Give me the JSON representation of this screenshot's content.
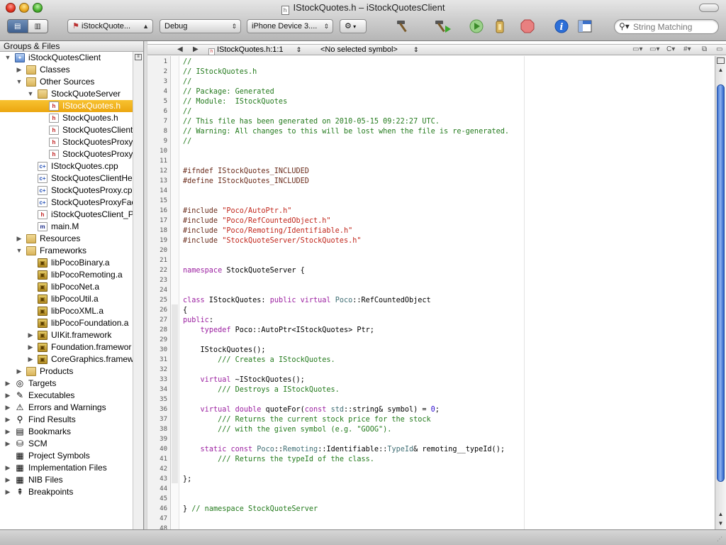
{
  "window": {
    "title": "IStockQuotes.h – iStockQuotesClient"
  },
  "toolbar": {
    "target": "iStockQuote...",
    "configuration": "Debug",
    "sdk": "iPhone Device 3....",
    "search_placeholder": "String Matching"
  },
  "sidebar": {
    "header": "Groups & Files",
    "items": [
      {
        "label": "iStockQuotesClient",
        "indent": 0,
        "disc": "open",
        "icon": "project"
      },
      {
        "label": "Classes",
        "indent": 1,
        "disc": "closed",
        "icon": "folder"
      },
      {
        "label": "Other Sources",
        "indent": 1,
        "disc": "open",
        "icon": "folder"
      },
      {
        "label": "StockQuoteServer",
        "indent": 2,
        "disc": "open",
        "icon": "folder"
      },
      {
        "label": "IStockQuotes.h",
        "indent": 3,
        "disc": "none",
        "icon": "h",
        "selected": true
      },
      {
        "label": "StockQuotes.h",
        "indent": 3,
        "disc": "none",
        "icon": "h"
      },
      {
        "label": "StockQuotesClient",
        "indent": 3,
        "disc": "none",
        "icon": "h"
      },
      {
        "label": "StockQuotesProxy.",
        "indent": 3,
        "disc": "none",
        "icon": "h"
      },
      {
        "label": "StockQuotesProxyF",
        "indent": 3,
        "disc": "none",
        "icon": "h"
      },
      {
        "label": "IStockQuotes.cpp",
        "indent": 2,
        "disc": "none",
        "icon": "cpp"
      },
      {
        "label": "StockQuotesClientHel",
        "indent": 2,
        "disc": "none",
        "icon": "cpp"
      },
      {
        "label": "StockQuotesProxy.cpp",
        "indent": 2,
        "disc": "none",
        "icon": "cpp"
      },
      {
        "label": "StockQuotesProxyFac",
        "indent": 2,
        "disc": "none",
        "icon": "cpp"
      },
      {
        "label": "iStockQuotesClient_Pr",
        "indent": 2,
        "disc": "none",
        "icon": "h"
      },
      {
        "label": "main.M",
        "indent": 2,
        "disc": "none",
        "icon": "m"
      },
      {
        "label": "Resources",
        "indent": 1,
        "disc": "closed",
        "icon": "folder"
      },
      {
        "label": "Frameworks",
        "indent": 1,
        "disc": "open",
        "icon": "folder"
      },
      {
        "label": "libPocoBinary.a",
        "indent": 2,
        "disc": "none",
        "icon": "lib"
      },
      {
        "label": "libPocoRemoting.a",
        "indent": 2,
        "disc": "none",
        "icon": "lib"
      },
      {
        "label": "libPocoNet.a",
        "indent": 2,
        "disc": "none",
        "icon": "lib"
      },
      {
        "label": "libPocoUtil.a",
        "indent": 2,
        "disc": "none",
        "icon": "lib"
      },
      {
        "label": "libPocoXML.a",
        "indent": 2,
        "disc": "none",
        "icon": "lib"
      },
      {
        "label": "libPocoFoundation.a",
        "indent": 2,
        "disc": "none",
        "icon": "lib"
      },
      {
        "label": "UIKit.framework",
        "indent": 2,
        "disc": "closed",
        "icon": "lib"
      },
      {
        "label": "Foundation.framewor",
        "indent": 2,
        "disc": "closed",
        "icon": "lib"
      },
      {
        "label": "CoreGraphics.framew",
        "indent": 2,
        "disc": "closed",
        "icon": "lib"
      },
      {
        "label": "Products",
        "indent": 1,
        "disc": "closed",
        "icon": "folder"
      },
      {
        "label": "Targets",
        "indent": 0,
        "disc": "closed",
        "icon": "group",
        "glyph": "◎"
      },
      {
        "label": "Executables",
        "indent": 0,
        "disc": "closed",
        "icon": "group",
        "glyph": "✎"
      },
      {
        "label": "Errors and Warnings",
        "indent": 0,
        "disc": "closed",
        "icon": "group",
        "glyph": "⚠"
      },
      {
        "label": "Find Results",
        "indent": 0,
        "disc": "closed",
        "icon": "group",
        "glyph": "⚲"
      },
      {
        "label": "Bookmarks",
        "indent": 0,
        "disc": "closed",
        "icon": "group",
        "glyph": "▤"
      },
      {
        "label": "SCM",
        "indent": 0,
        "disc": "closed",
        "icon": "group",
        "glyph": "⛁"
      },
      {
        "label": "Project Symbols",
        "indent": 0,
        "disc": "none",
        "icon": "group",
        "glyph": "▦"
      },
      {
        "label": "Implementation Files",
        "indent": 0,
        "disc": "closed",
        "icon": "group",
        "glyph": "▦"
      },
      {
        "label": "NIB Files",
        "indent": 0,
        "disc": "closed",
        "icon": "group",
        "glyph": "▦"
      },
      {
        "label": "Breakpoints",
        "indent": 0,
        "disc": "closed",
        "icon": "group",
        "glyph": "⇞"
      }
    ]
  },
  "navbar": {
    "file_location": "IStockQuotes.h:1:1",
    "symbol": "<No selected symbol>",
    "right_items": [
      "C",
      "#"
    ]
  },
  "editor": {
    "lines": [
      [
        [
          "c-com",
          "//"
        ]
      ],
      [
        [
          "c-com",
          "// IStockQuotes.h"
        ]
      ],
      [
        [
          "c-com",
          "//"
        ]
      ],
      [
        [
          "c-com",
          "// Package: Generated"
        ]
      ],
      [
        [
          "c-com",
          "// Module:  IStockQuotes"
        ]
      ],
      [
        [
          "c-com",
          "//"
        ]
      ],
      [
        [
          "c-com",
          "// This file has been generated on 2010-05-15 09:22:27 UTC."
        ]
      ],
      [
        [
          "c-com",
          "// Warning: All changes to this will be lost when the file is re-generated."
        ]
      ],
      [
        [
          "c-com",
          "//"
        ]
      ],
      [],
      [],
      [
        [
          "c-pp",
          "#ifndef IStockQuotes_INCLUDED"
        ]
      ],
      [
        [
          "c-pp",
          "#define IStockQuotes_INCLUDED"
        ]
      ],
      [],
      [],
      [
        [
          "c-pp",
          "#include "
        ],
        [
          "c-str",
          "\"Poco/AutoPtr.h\""
        ]
      ],
      [
        [
          "c-pp",
          "#include "
        ],
        [
          "c-str",
          "\"Poco/RefCountedObject.h\""
        ]
      ],
      [
        [
          "c-pp",
          "#include "
        ],
        [
          "c-str",
          "\"Poco/Remoting/Identifiable.h\""
        ]
      ],
      [
        [
          "c-pp",
          "#include "
        ],
        [
          "c-str",
          "\"StockQuoteServer/StockQuotes.h\""
        ]
      ],
      [],
      [],
      [
        [
          "c-kw",
          "namespace"
        ],
        [
          "c-pl",
          " StockQuoteServer {"
        ]
      ],
      [],
      [],
      [
        [
          "c-kw",
          "class"
        ],
        [
          "c-pl",
          " IStockQuotes: "
        ],
        [
          "c-kw",
          "public virtual"
        ],
        [
          "c-pl",
          " "
        ],
        [
          "c-ty",
          "Poco"
        ],
        [
          "c-pl",
          "::RefCountedObject"
        ]
      ],
      [
        [
          "c-pl",
          "{"
        ]
      ],
      [
        [
          "c-kw",
          "public"
        ],
        [
          "c-pl",
          ":"
        ]
      ],
      [
        [
          "c-pl",
          "    "
        ],
        [
          "c-kw",
          "typedef"
        ],
        [
          "c-pl",
          " Poco::AutoPtr<IStockQuotes> Ptr;"
        ]
      ],
      [],
      [
        [
          "c-pl",
          "    IStockQuotes();"
        ]
      ],
      [
        [
          "c-pl",
          "        "
        ],
        [
          "c-com",
          "/// Creates a IStockQuotes."
        ]
      ],
      [],
      [
        [
          "c-pl",
          "    "
        ],
        [
          "c-kw",
          "virtual"
        ],
        [
          "c-pl",
          " ~IStockQuotes();"
        ]
      ],
      [
        [
          "c-pl",
          "        "
        ],
        [
          "c-com",
          "/// Destroys a IStockQuotes."
        ]
      ],
      [],
      [
        [
          "c-pl",
          "    "
        ],
        [
          "c-kw",
          "virtual double"
        ],
        [
          "c-pl",
          " quoteFor("
        ],
        [
          "c-kw",
          "const"
        ],
        [
          "c-pl",
          " "
        ],
        [
          "c-ty",
          "std"
        ],
        [
          "c-pl",
          "::string& symbol) = "
        ],
        [
          "c-num",
          "0"
        ],
        [
          "c-pl",
          ";"
        ]
      ],
      [
        [
          "c-pl",
          "        "
        ],
        [
          "c-com",
          "/// Returns the current stock price for the stock"
        ]
      ],
      [
        [
          "c-pl",
          "        "
        ],
        [
          "c-com",
          "/// with the given symbol (e.g. \"GOOG\")."
        ]
      ],
      [],
      [
        [
          "c-pl",
          "    "
        ],
        [
          "c-kw",
          "static const"
        ],
        [
          "c-pl",
          " "
        ],
        [
          "c-ty",
          "Poco"
        ],
        [
          "c-pl",
          "::"
        ],
        [
          "c-ty",
          "Remoting"
        ],
        [
          "c-pl",
          "::Identifiable::"
        ],
        [
          "c-ty",
          "TypeId"
        ],
        [
          "c-pl",
          "& remoting__typeId();"
        ]
      ],
      [
        [
          "c-pl",
          "        "
        ],
        [
          "c-com",
          "/// Returns the typeId of the class."
        ]
      ],
      [],
      [
        [
          "c-pl",
          "};"
        ]
      ],
      [],
      [],
      [
        [
          "c-pl",
          "} "
        ],
        [
          "c-com",
          "// namespace StockQuoteServer"
        ]
      ],
      [],
      []
    ],
    "line_numbers": [
      "1",
      "2",
      "3",
      "4",
      "5",
      "6",
      "7",
      "8",
      "9",
      "10",
      "11",
      "12",
      "13",
      "14",
      "15",
      "16",
      "17",
      "18",
      "19",
      "20",
      "21",
      "22",
      "23",
      "24",
      "25",
      "26",
      "27",
      "28",
      "29",
      "30",
      "31",
      "32",
      "33",
      "34",
      "35",
      "36",
      "37",
      "38",
      "39",
      "40",
      "41",
      "42",
      "43",
      "44",
      "45",
      "46",
      "47",
      "48"
    ]
  },
  "icons": {
    "build": "hammer-icon",
    "build_and_go": "build-and-go-icon",
    "run": "run-icon",
    "tasks": "tasks-icon",
    "stop": "stop-icon",
    "info": "info-icon",
    "editor_toggle": "editor-toggle-icon"
  }
}
